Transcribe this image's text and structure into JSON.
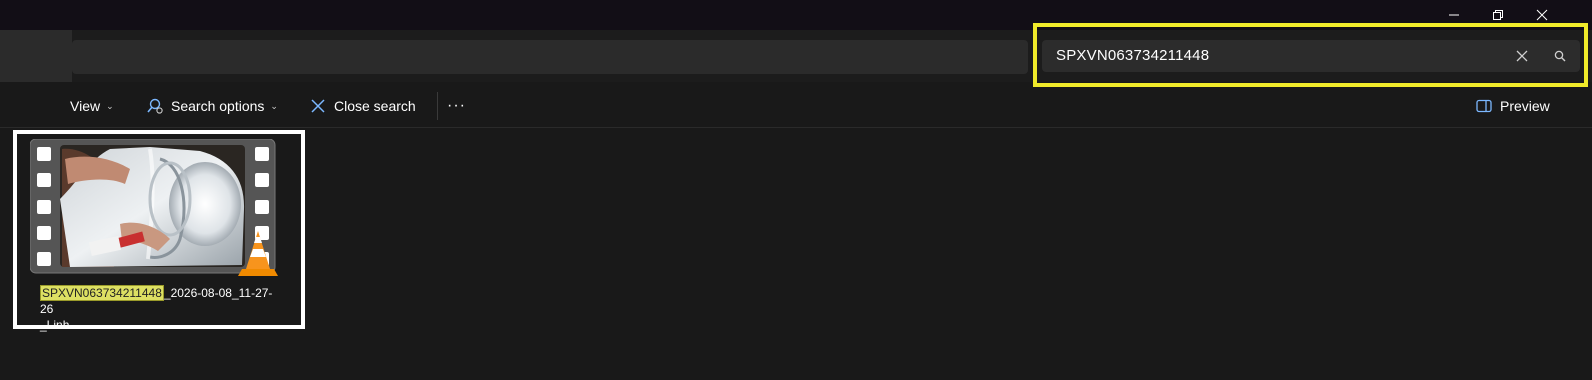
{
  "window": {
    "controls": [
      "minimize",
      "restore",
      "close"
    ]
  },
  "search": {
    "value": "SPXVN063734211448",
    "clear_icon": "close-icon",
    "search_icon": "search-icon"
  },
  "toolbar": {
    "view_label": "View",
    "search_options_label": "Search options",
    "close_search_label": "Close search",
    "more_label": "···",
    "preview_label": "Preview"
  },
  "file": {
    "name_match": "SPXVN063734211448",
    "name_rest": "_2026-08-08_11-27-26",
    "name_line2": "_Linh",
    "type_icon": "vlc-cone-icon"
  },
  "colors": {
    "highlight_box": "#f0ea2a",
    "selection_box": "#ffffff",
    "search_match": "#dde063",
    "background": "#191919"
  }
}
